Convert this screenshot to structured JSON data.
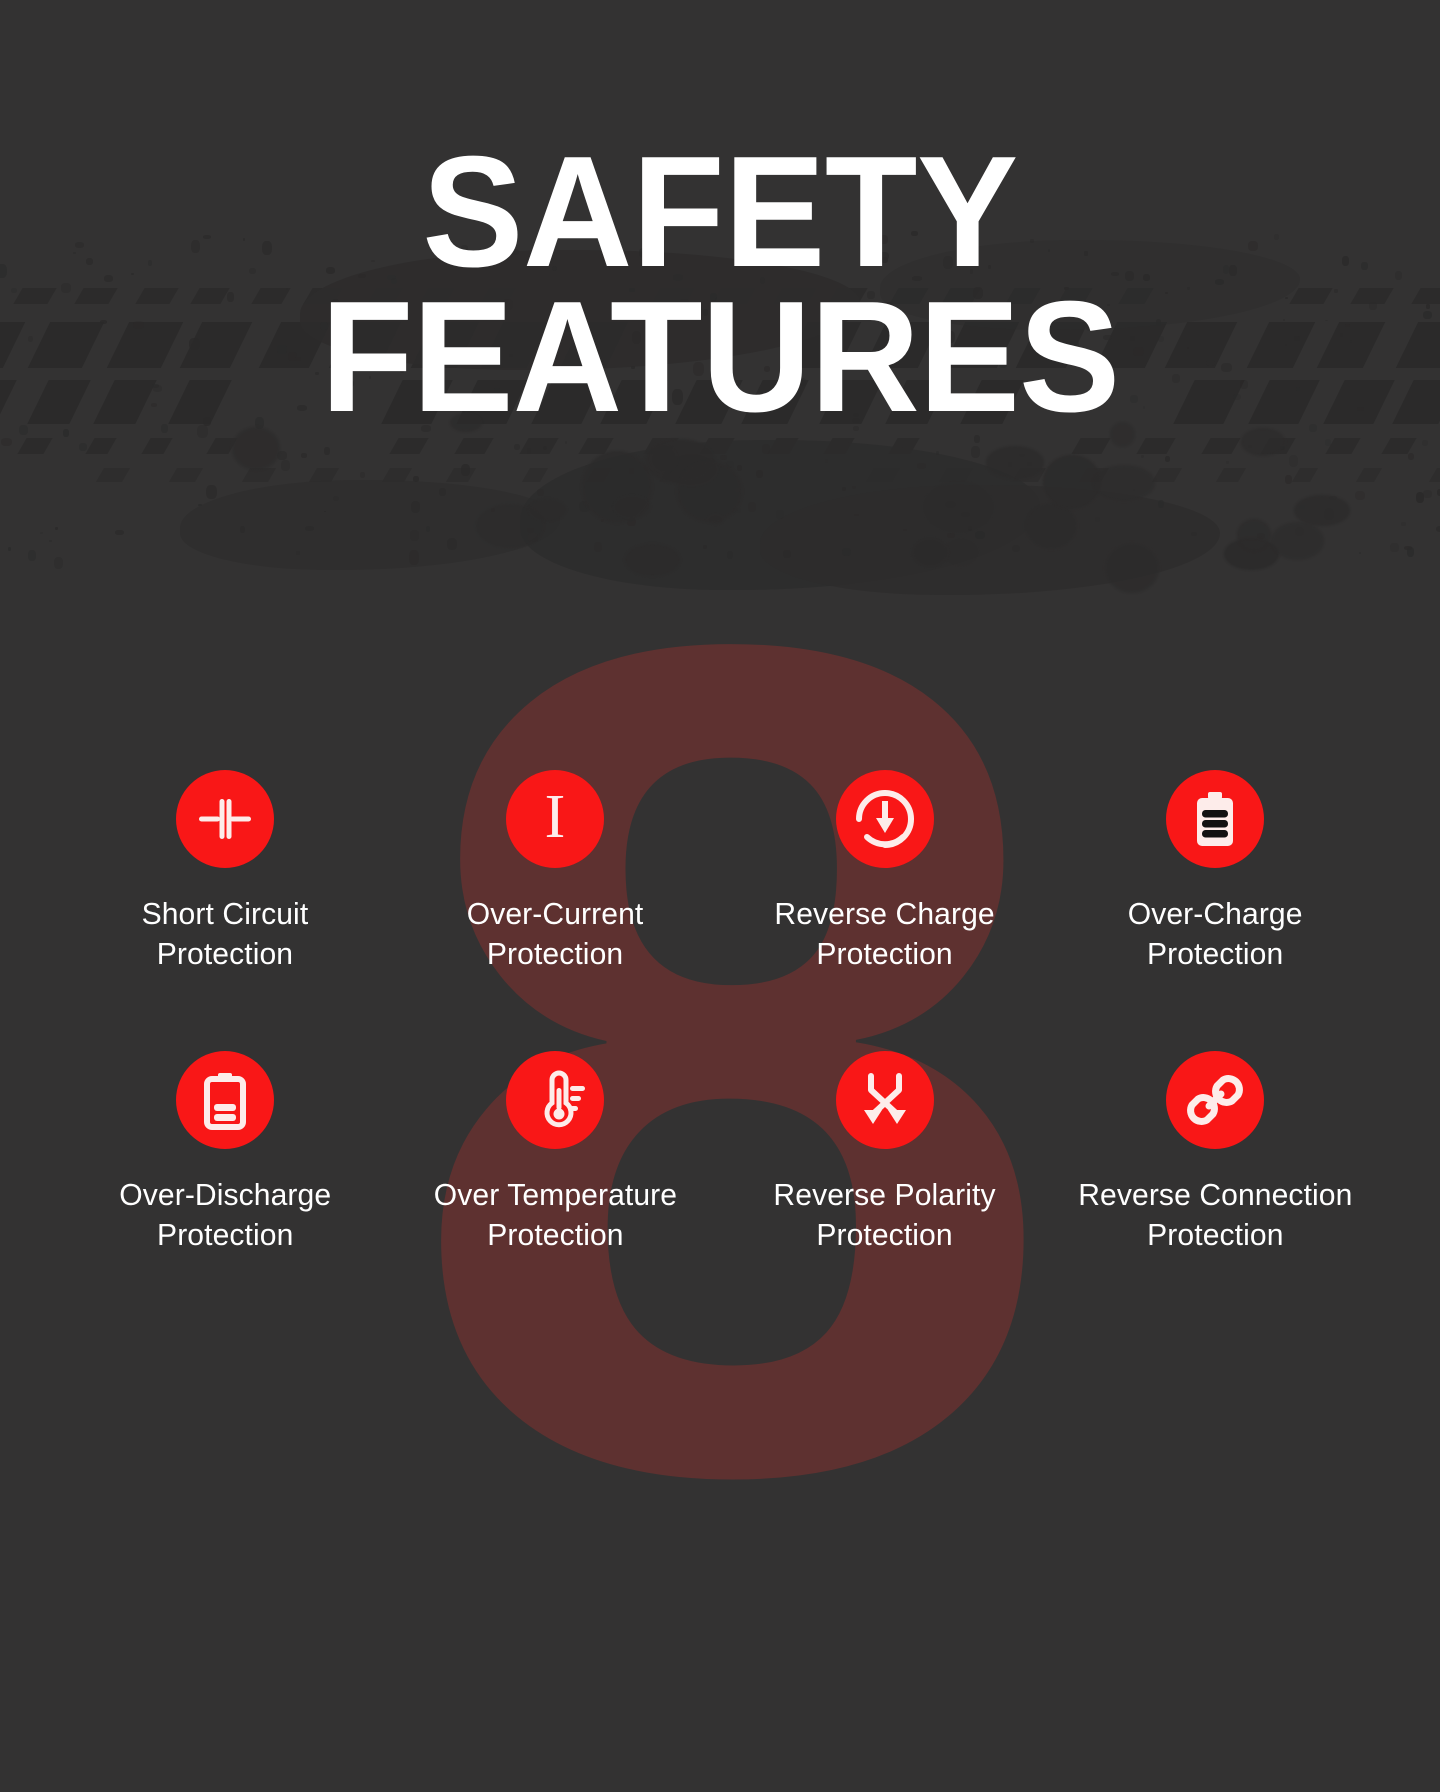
{
  "theme": {
    "background": "#333232",
    "accent": "#f91717",
    "watermark_color": "#5e3130",
    "text_color": "#ffffff"
  },
  "header": {
    "title_line1": "SAFETY",
    "title_line2": "FEATURES"
  },
  "watermark": {
    "text": "8"
  },
  "features": [
    {
      "icon": "capacitor-icon",
      "label_line1": "Short Circuit",
      "label_line2": "Protection"
    },
    {
      "icon": "current-i-icon",
      "label_line1": "Over-Current",
      "label_line2": "Protection"
    },
    {
      "icon": "reverse-charge-icon",
      "label_line1": "Reverse Charge",
      "label_line2": "Protection"
    },
    {
      "icon": "battery-full-icon",
      "label_line1": "Over-Charge",
      "label_line2": "Protection"
    },
    {
      "icon": "battery-low-icon",
      "label_line1": "Over-Discharge",
      "label_line2": "Protection"
    },
    {
      "icon": "thermometer-icon",
      "label_line1": "Over Temperature",
      "label_line2": "Protection"
    },
    {
      "icon": "crossed-arrows-icon",
      "label_line1": "Reverse Polarity",
      "label_line2": "Protection"
    },
    {
      "icon": "chain-link-icon",
      "label_line1": "Reverse Connection",
      "label_line2": "Protection"
    }
  ]
}
